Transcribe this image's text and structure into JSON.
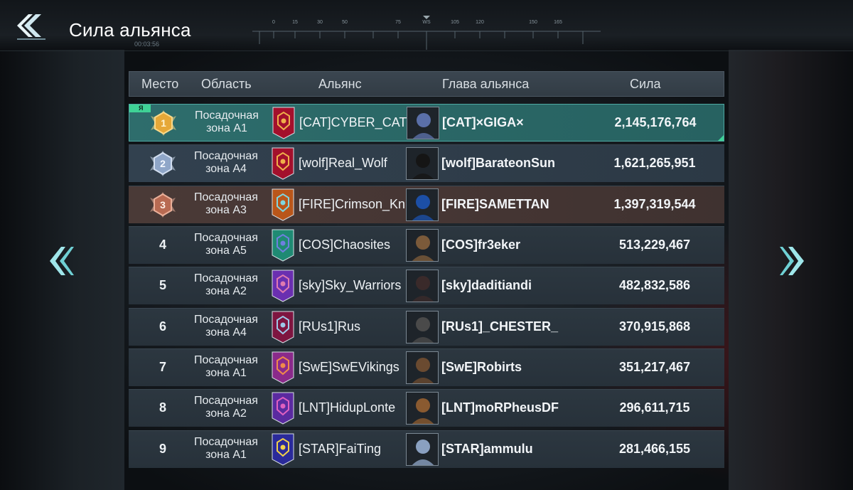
{
  "header": {
    "title": "Сила альянса",
    "timer": "00:03:56",
    "ruler_labels": [
      "0",
      "15",
      "30",
      "50",
      "75",
      "WS",
      "105",
      "120",
      "150",
      "165"
    ]
  },
  "table": {
    "columns": {
      "rank": "Место",
      "region": "Область",
      "alliance": "Альянс",
      "leader": "Глава альянса",
      "power": "Сила"
    },
    "me_tag": "Я",
    "rows": [
      {
        "rank": "1",
        "region_line1": "Посадочная",
        "region_line2": "зона A1",
        "alliance": "[CAT]CYBER_CATS",
        "leader": "[CAT]×GIGA×",
        "power": "2,145,176,764",
        "emblem_color": "#a3102c",
        "emblem_accent": "#f0b04a",
        "avatar_color": "#5a6fa8"
      },
      {
        "rank": "2",
        "region_line1": "Посадочная",
        "region_line2": "зона A4",
        "alliance": "[wolf]Real_Wolf",
        "leader": "[wolf]BarateonSun",
        "power": "1,621,265,951",
        "emblem_color": "#a3102c",
        "emblem_accent": "#f0b04a",
        "avatar_color": "#151515"
      },
      {
        "rank": "3",
        "region_line1": "Посадочная",
        "region_line2": "зона A3",
        "alliance": "[FIRE]Crimson_Knight",
        "leader": "[FIRE]SAMETTAN",
        "power": "1,397,319,544",
        "emblem_color": "#b9561a",
        "emblem_accent": "#7fd6e0",
        "avatar_color": "#1c4fa6"
      },
      {
        "rank": "4",
        "region_line1": "Посадочная",
        "region_line2": "зона A5",
        "alliance": "[COS]Chaosites",
        "leader": "[COS]fr3eker",
        "power": "513,229,467",
        "emblem_color": "#1f8a73",
        "emblem_accent": "#6f7fe0",
        "avatar_color": "#7b5a3a"
      },
      {
        "rank": "5",
        "region_line1": "Посадочная",
        "region_line2": "зона A2",
        "alliance": "[sky]Sky_Warriors",
        "leader": "[sky]daditiandi",
        "power": "482,832,586",
        "emblem_color": "#6a2fb0",
        "emblem_accent": "#e07ab0",
        "avatar_color": "#3a2a2a"
      },
      {
        "rank": "6",
        "region_line1": "Посадочная",
        "region_line2": "зона A4",
        "alliance": "[RUs1]Rus",
        "leader": "[RUs1]_CHESTER_",
        "power": "370,915,868",
        "emblem_color": "#7e1540",
        "emblem_accent": "#9ec8e8",
        "avatar_color": "#4a4a4a"
      },
      {
        "rank": "7",
        "region_line1": "Посадочная",
        "region_line2": "зона A1",
        "alliance": "[SwE]SwEVikings",
        "leader": "[SwE]Robirts",
        "power": "351,217,467",
        "emblem_color": "#8a2a8a",
        "emblem_accent": "#f08a4a",
        "avatar_color": "#6a4a30"
      },
      {
        "rank": "8",
        "region_line1": "Посадочная",
        "region_line2": "зона A2",
        "alliance": "[LNT]HidupLonte",
        "leader": "[LNT]moRPheusDF",
        "power": "296,611,715",
        "emblem_color": "#5a2aa0",
        "emblem_accent": "#e060c0",
        "avatar_color": "#8a5a30"
      },
      {
        "rank": "9",
        "region_line1": "Посадочная",
        "region_line2": "зона A1",
        "alliance": "[STAR]FaiTing",
        "leader": "[STAR]ammulu",
        "power": "281,466,155",
        "emblem_color": "#2a2a9a",
        "emblem_accent": "#f0d04a",
        "avatar_color": "#8aa0c0"
      }
    ]
  }
}
